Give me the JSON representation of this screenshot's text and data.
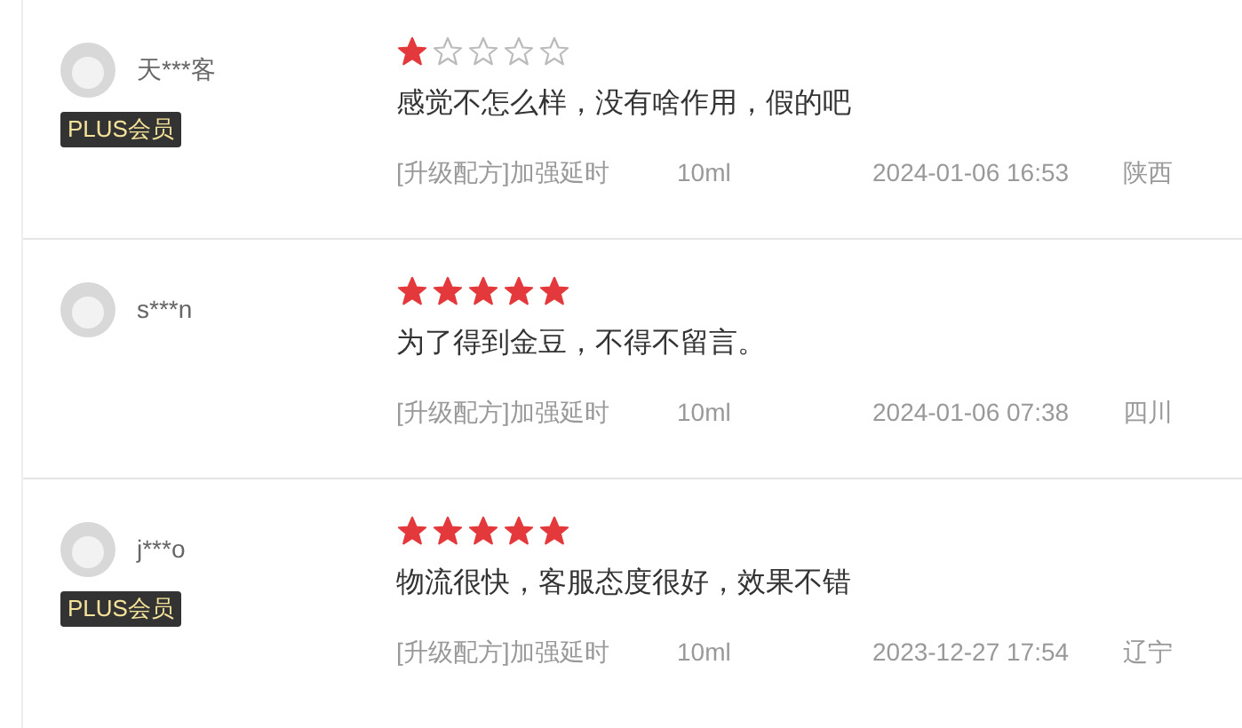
{
  "reviews": [
    {
      "user": "天***客",
      "plus_badge": "PLUS会员",
      "stars": 1,
      "comment": "感觉不怎么样，没有啥作用，假的吧",
      "spec": "[升级配方]加强延时",
      "size": "10ml",
      "time": "2024-01-06 16:53",
      "region": "陕西"
    },
    {
      "user": "s***n",
      "stars": 5,
      "comment": "为了得到金豆，不得不留言。",
      "spec": "[升级配方]加强延时",
      "size": "10ml",
      "time": "2024-01-06 07:38",
      "region": "四川"
    },
    {
      "user": "j***o",
      "plus_badge": "PLUS会员",
      "stars": 5,
      "comment": "物流很快，客服态度很好，效果不错",
      "spec": "[升级配方]加强延时",
      "size": "10ml",
      "time": "2023-12-27 17:54",
      "region": "辽宁"
    }
  ]
}
